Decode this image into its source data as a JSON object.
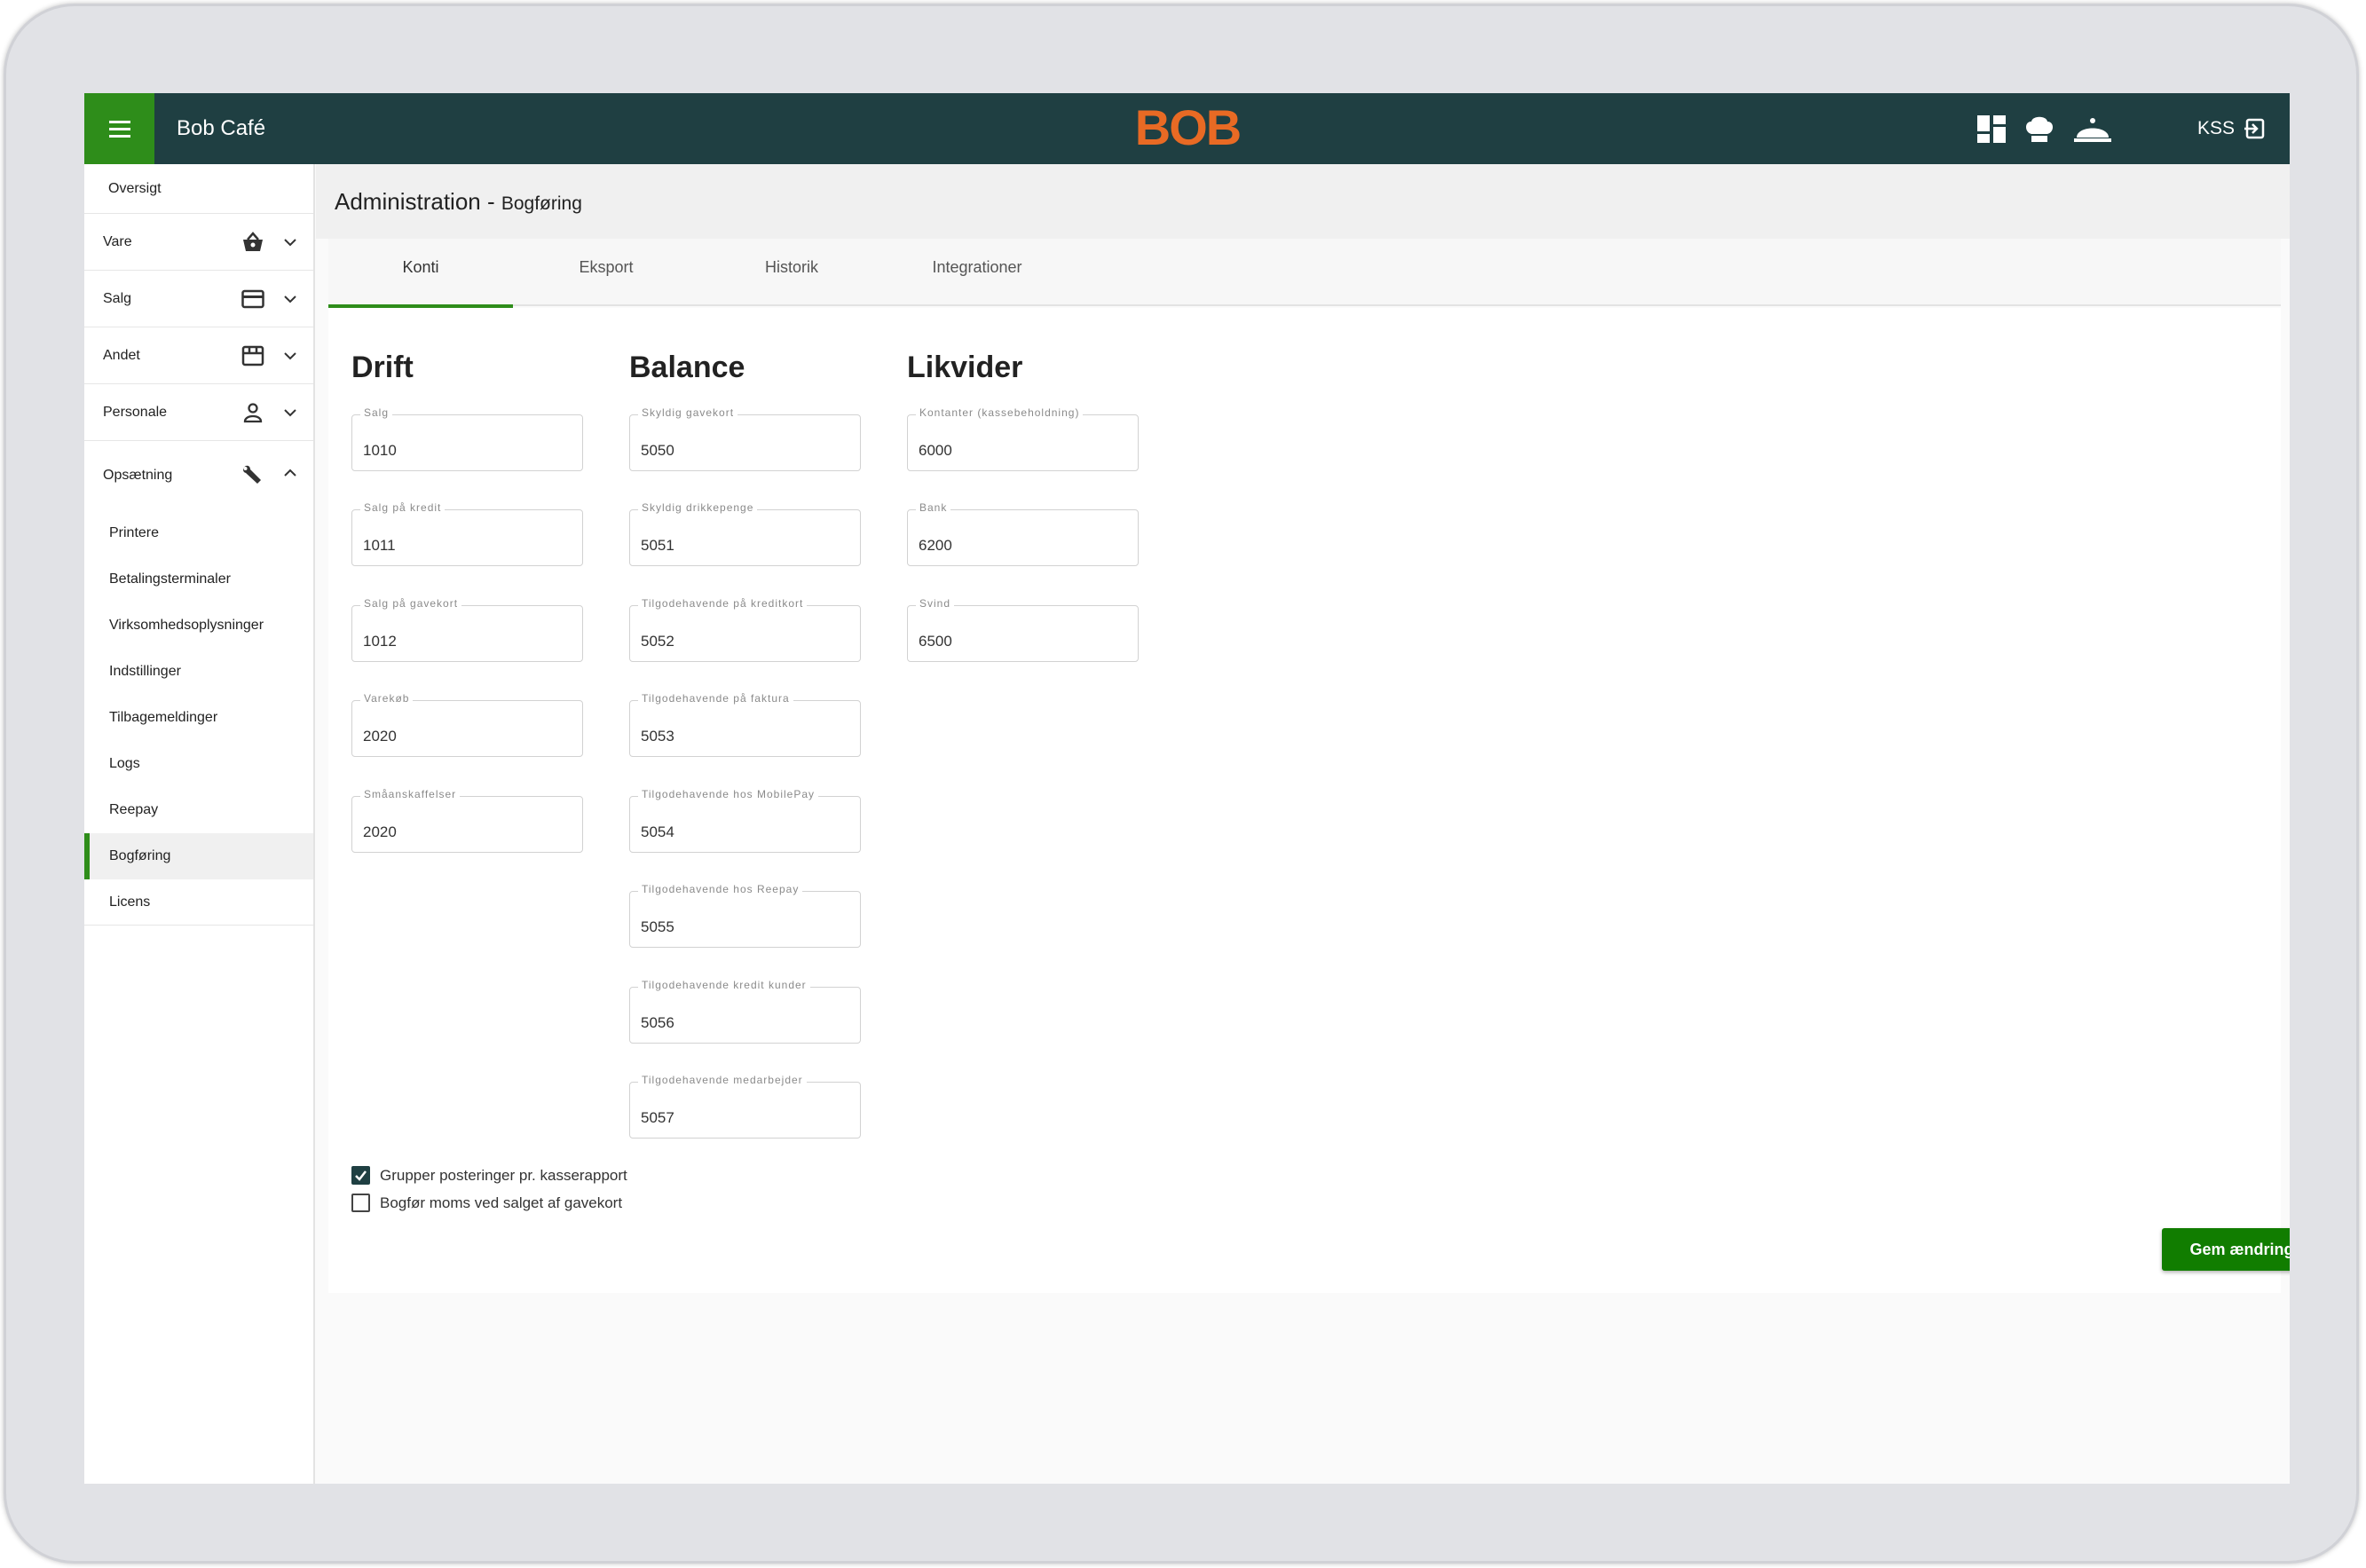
{
  "header": {
    "app_title": "Bob Café",
    "logo_text": "BOB",
    "user_code": "KSS",
    "icons": [
      "menu-icon",
      "dashboard-icon",
      "chef-hat-icon",
      "cloche-icon",
      "logout-icon"
    ]
  },
  "sidebar": {
    "overview": "Oversigt",
    "groups": [
      {
        "label": "Vare",
        "icon": "basket-icon"
      },
      {
        "label": "Salg",
        "icon": "card-icon"
      },
      {
        "label": "Andet",
        "icon": "store-icon"
      },
      {
        "label": "Personale",
        "icon": "person-icon"
      },
      {
        "label": "Opsætning",
        "icon": "wrench-icon"
      }
    ],
    "sub_items": [
      "Printere",
      "Betalingsterminaler",
      "Virksomhedsoplysninger",
      "Indstillinger",
      "Tilbagemeldinger",
      "Logs",
      "Reepay",
      "Bogføring",
      "Licens"
    ],
    "active_sub": "Bogføring"
  },
  "page": {
    "title": "Administration - ",
    "subtitle": "Bogføring"
  },
  "tabs": [
    "Konti",
    "Eksport",
    "Historik",
    "Integrationer"
  ],
  "columns": [
    {
      "heading": "Drift",
      "fields": [
        {
          "label": "Salg",
          "value": "1010"
        },
        {
          "label": "Salg på kredit",
          "value": "1011"
        },
        {
          "label": "Salg på gavekort",
          "value": "1012"
        },
        {
          "label": "Varekøb",
          "value": "2020"
        },
        {
          "label": "Småanskaffelser",
          "value": "2020"
        }
      ]
    },
    {
      "heading": "Balance",
      "fields": [
        {
          "label": "Skyldig gavekort",
          "value": "5050"
        },
        {
          "label": "Skyldig drikkepenge",
          "value": "5051"
        },
        {
          "label": "Tilgodehavende på kreditkort",
          "value": "5052"
        },
        {
          "label": "Tilgodehavende på faktura",
          "value": "5053"
        },
        {
          "label": "Tilgodehavende hos MobilePay",
          "value": "5054"
        },
        {
          "label": "Tilgodehavende hos Reepay",
          "value": "5055"
        },
        {
          "label": "Tilgodehavende kredit kunder",
          "value": "5056"
        },
        {
          "label": "Tilgodehavende medarbejder",
          "value": "5057"
        }
      ]
    },
    {
      "heading": "Likvider",
      "fields": [
        {
          "label": "Kontanter (kassebeholdning)",
          "value": "6000"
        },
        {
          "label": "Bank",
          "value": "6200"
        },
        {
          "label": "Svind",
          "value": "6500"
        }
      ]
    }
  ],
  "options": [
    {
      "label": "Grupper posteringer pr. kasserapport",
      "checked": true
    },
    {
      "label": "Bogfør moms ved salget af gavekort",
      "checked": false
    }
  ],
  "save_label": "Gem ændringer",
  "colors": {
    "header": "#1f3f42",
    "accent": "#2e8d1a",
    "logo": "#e86a24",
    "save": "#117d00"
  }
}
